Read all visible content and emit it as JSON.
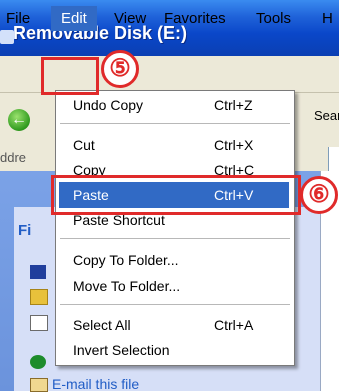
{
  "window": {
    "title": "Removable Disk (E:)"
  },
  "menubar": {
    "items": [
      "File",
      "Edit",
      "View",
      "Favorites",
      "Tools",
      "H"
    ]
  },
  "toolbar": {
    "search_fragment": "Sear"
  },
  "address": {
    "label_fragment": "ddre"
  },
  "taskpane": {
    "title_fragment": "Fi",
    "email_link": "E-mail this file"
  },
  "edit_menu": {
    "items": [
      {
        "label": "Undo Copy",
        "shortcut": "Ctrl+Z"
      },
      {
        "label": "Cut",
        "shortcut": "Ctrl+X"
      },
      {
        "label": "Copy",
        "shortcut": "Ctrl+C"
      },
      {
        "label": "Paste",
        "shortcut": "Ctrl+V"
      },
      {
        "label": "Paste Shortcut",
        "shortcut": ""
      },
      {
        "label": "Copy To Folder...",
        "shortcut": ""
      },
      {
        "label": "Move To Folder...",
        "shortcut": ""
      },
      {
        "label": "Select All",
        "shortcut": "Ctrl+A"
      },
      {
        "label": "Invert Selection",
        "shortcut": ""
      }
    ],
    "highlighted": "Paste"
  },
  "annotations": {
    "step5": "⑤",
    "step6": "⑥",
    "color": "#e02a2a"
  },
  "colors": {
    "titlebar": "#0a47c9",
    "menu_highlight": "#316ac5",
    "chrome": "#ece9d8"
  }
}
